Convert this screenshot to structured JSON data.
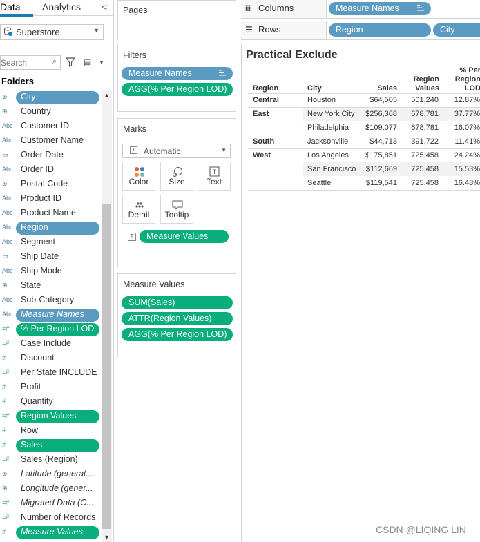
{
  "tabs": {
    "data": "Data",
    "analytics": "Analytics",
    "collapse": "<"
  },
  "datasource": {
    "name": "Superstore"
  },
  "search": {
    "placeholder": "Search"
  },
  "folders_label": "Folders",
  "fields": [
    {
      "type": "geo",
      "label": "City",
      "pill": "dim"
    },
    {
      "type": "geo",
      "label": "Country"
    },
    {
      "type": "abc",
      "label": "Customer ID"
    },
    {
      "type": "abc",
      "label": "Customer Name"
    },
    {
      "type": "date",
      "label": "Order Date"
    },
    {
      "type": "abc",
      "label": "Order ID"
    },
    {
      "type": "geo",
      "label": "Postal Code"
    },
    {
      "type": "abc",
      "label": "Product ID"
    },
    {
      "type": "abc",
      "label": "Product Name"
    },
    {
      "type": "abc",
      "label": "Region",
      "pill": "dim"
    },
    {
      "type": "abc",
      "label": "Segment"
    },
    {
      "type": "date",
      "label": "Ship Date"
    },
    {
      "type": "abc",
      "label": "Ship Mode"
    },
    {
      "type": "geo",
      "label": "State"
    },
    {
      "type": "abc",
      "label": "Sub-Category"
    },
    {
      "type": "abc",
      "label": "Measure Names",
      "pill": "dim",
      "italic": true
    },
    {
      "type": "calc",
      "label": "% Per Region LOD",
      "pill": "meas"
    },
    {
      "type": "calc",
      "label": "Case Include"
    },
    {
      "type": "num",
      "label": "Discount"
    },
    {
      "type": "calc",
      "label": "Per State INCLUDE"
    },
    {
      "type": "num",
      "label": "Profit"
    },
    {
      "type": "num",
      "label": "Quantity"
    },
    {
      "type": "calc",
      "label": "Region Values",
      "pill": "meas"
    },
    {
      "type": "num",
      "label": "Row"
    },
    {
      "type": "num",
      "label": "Sales",
      "pill": "meas"
    },
    {
      "type": "calc",
      "label": "Sales (Region)"
    },
    {
      "type": "geo",
      "label": "Latitude (generat...",
      "italic": true
    },
    {
      "type": "geo",
      "label": "Longitude (gener...",
      "italic": true
    },
    {
      "type": "calc",
      "label": "Migrated Data (C...",
      "italic": true
    },
    {
      "type": "calc",
      "label": "Number of Records"
    },
    {
      "type": "num",
      "label": "Measure Values",
      "pill": "meas",
      "italic": true
    }
  ],
  "pages": {
    "title": "Pages"
  },
  "filters": {
    "title": "Filters",
    "pills": [
      "Measure Names",
      "AGG(% Per Region LOD)"
    ]
  },
  "marks": {
    "title": "Marks",
    "type": "Automatic",
    "buttons": [
      "Color",
      "Size",
      "Text",
      "Detail",
      "Tooltip"
    ],
    "text_pill": "Measure Values"
  },
  "measure_values": {
    "title": "Measure Values",
    "pills": [
      "SUM(Sales)",
      "ATTR(Region Values)",
      "AGG(% Per Region LOD)"
    ]
  },
  "shelves": {
    "columns": {
      "label": "Columns",
      "pills": [
        "Measure Names"
      ]
    },
    "rows": {
      "label": "Rows",
      "pills": [
        "Region",
        "City"
      ]
    }
  },
  "view": {
    "title": "Practical Exclude",
    "headers": {
      "region": "Region",
      "city": "City",
      "sales": "Sales",
      "region_values": [
        "Region",
        "Values"
      ],
      "pct": [
        "% Per",
        "Region",
        "LOD"
      ]
    },
    "rows": [
      {
        "region": "Central",
        "city": "Houston",
        "sales": "$64,505",
        "rv": "501,240",
        "pct": "12.87%"
      },
      {
        "region": "East",
        "city": "New York City",
        "sales": "$256,368",
        "rv": "678,781",
        "pct": "37.77%"
      },
      {
        "region": "",
        "city": "Philadelphia",
        "sales": "$109,077",
        "rv": "678,781",
        "pct": "16.07%"
      },
      {
        "region": "South",
        "city": "Jacksonville",
        "sales": "$44,713",
        "rv": "391,722",
        "pct": "11.41%"
      },
      {
        "region": "West",
        "city": "Los Angeles",
        "sales": "$175,851",
        "rv": "725,458",
        "pct": "24.24%"
      },
      {
        "region": "",
        "city": "San Francisco",
        "sales": "$112,669",
        "rv": "725,458",
        "pct": "15.53%"
      },
      {
        "region": "",
        "city": "Seattle",
        "sales": "$119,541",
        "rv": "725,458",
        "pct": "16.48%"
      }
    ]
  },
  "watermark": "CSDN @LIQING LIN",
  "colors": {
    "dimension": "#5b9bc2",
    "measure": "#09ae7c",
    "accent": "#1f77b4"
  }
}
